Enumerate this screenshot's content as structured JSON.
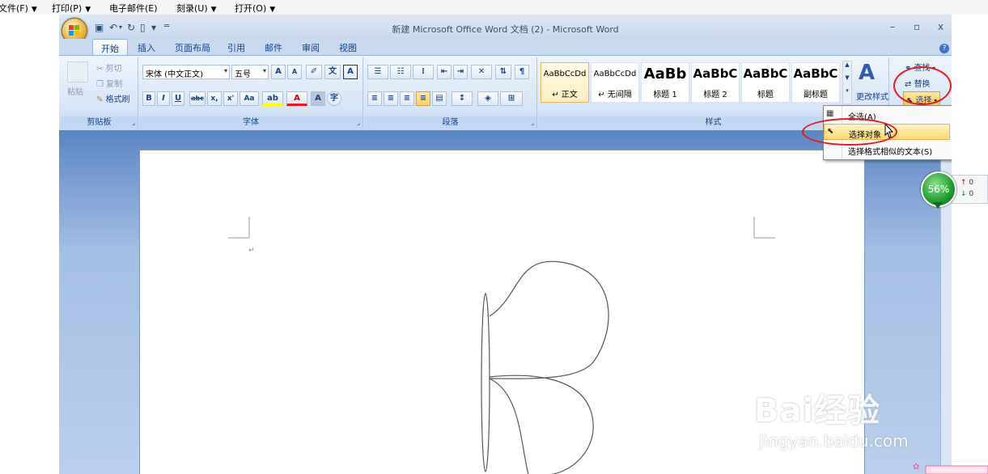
{
  "explorer_menu": [
    {
      "label": "文件(F)",
      "has_arrow": true
    },
    {
      "label": "打印(P)",
      "has_arrow": true
    },
    {
      "label": "电子邮件(E)",
      "has_arrow": false
    },
    {
      "label": "刻录(U)",
      "has_arrow": true
    },
    {
      "label": "打开(O)",
      "has_arrow": true
    }
  ],
  "window": {
    "title": "新建 Microsoft Office Word 文档 (2) - Microsoft Word",
    "minimize": "–",
    "restore": "▫",
    "close": "x"
  },
  "tabs": [
    {
      "label": "开始",
      "active": true
    },
    {
      "label": "插入",
      "active": false
    },
    {
      "label": "页面布局",
      "active": false
    },
    {
      "label": "引用",
      "active": false
    },
    {
      "label": "邮件",
      "active": false
    },
    {
      "label": "审阅",
      "active": false
    },
    {
      "label": "视图",
      "active": false
    }
  ],
  "clipboard": {
    "paste": "粘贴",
    "cut": "剪切",
    "copy": "复制",
    "format_painter": "格式刷",
    "group_label": "剪贴板"
  },
  "font": {
    "font_name": "宋体 (中文正文)",
    "font_size": "五号",
    "group_label": "字体",
    "grow": "A",
    "shrink": "A",
    "bold": "B",
    "italic": "I",
    "underline": "U",
    "strike": "abc",
    "subscript": "x,",
    "superscript": "x'",
    "change_case": "Aa"
  },
  "paragraph": {
    "group_label": "段落"
  },
  "styles": {
    "group_label": "样式",
    "items": [
      {
        "sample": "AaBbCcDd",
        "name": "↵ 正文",
        "selected": true
      },
      {
        "sample": "AaBbCcDd",
        "name": "↵ 无间隔",
        "selected": false
      },
      {
        "sample": "AaBb",
        "name": "标题 1",
        "selected": false
      },
      {
        "sample": "AaBbC",
        "name": "标题 2",
        "selected": false
      },
      {
        "sample": "AaBbC",
        "name": "标题",
        "selected": false
      },
      {
        "sample": "AaBbC",
        "name": "副标题",
        "selected": false
      }
    ],
    "change_styles": "更改样式"
  },
  "editing": {
    "find": "查找",
    "replace": "替换",
    "select": "选择"
  },
  "select_menu": {
    "items": [
      {
        "label": "全选(A)",
        "highlighted": false
      },
      {
        "label": "选择对象",
        "highlighted": true
      },
      {
        "label": "选择格式相似的文本(S)",
        "highlighted": false
      }
    ]
  },
  "zoom_bubble": "56%",
  "net_panel": {
    "up": "0",
    "down": "0"
  },
  "watermark": {
    "brand": "Bai经验",
    "url": "jingyan.baidu.com"
  },
  "colors": {
    "accent": "#15428b",
    "ribbon": "#d7e5f7",
    "highlight": "#ffd972",
    "annotation": "#e31b1b"
  }
}
